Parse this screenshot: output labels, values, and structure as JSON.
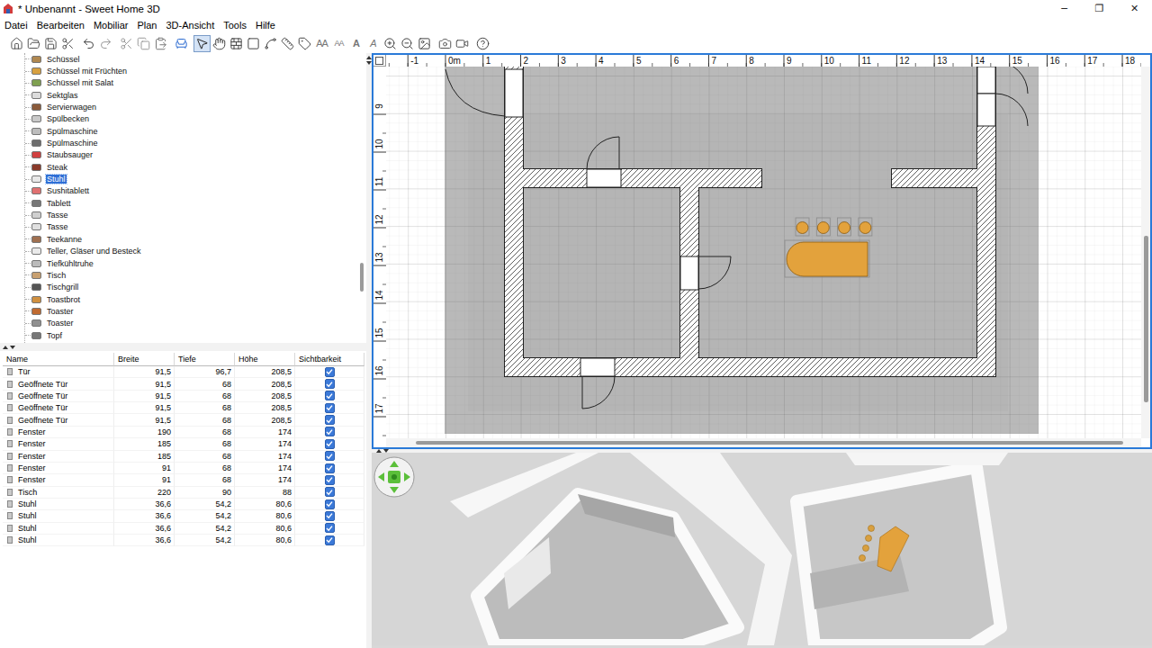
{
  "window": {
    "title": "* Unbenannt - Sweet Home 3D",
    "controls": [
      "─",
      "❐",
      "✕"
    ]
  },
  "menu": [
    "Datei",
    "Bearbeiten",
    "Mobiliar",
    "Plan",
    "3D-Ansicht",
    "Tools",
    "Hilfe"
  ],
  "toolbar": {
    "modes": [
      {
        "selected": true
      },
      {
        "selected": false
      },
      {
        "selected": false
      },
      {
        "selected": false
      },
      {
        "selected": false
      },
      {
        "selected": false
      },
      {
        "selected": false
      }
    ],
    "text_buttons": [
      {
        "glyph": "AA",
        "kind": "grow"
      },
      {
        "glyph": "AA",
        "kind": "shrink"
      },
      {
        "glyph": "A",
        "kind": "bold"
      },
      {
        "glyph": "A",
        "kind": "italic"
      }
    ]
  },
  "catalog": {
    "items": [
      {
        "name": "Schüssel",
        "selected": false
      },
      {
        "name": "Schüssel mit Früchten",
        "selected": false
      },
      {
        "name": "Schüssel mit Salat",
        "selected": false
      },
      {
        "name": "Sektglas",
        "selected": false
      },
      {
        "name": "Servierwagen",
        "selected": false
      },
      {
        "name": "Spülbecken",
        "selected": false
      },
      {
        "name": "Spülmaschine",
        "selected": false
      },
      {
        "name": "Spülmaschine",
        "selected": false
      },
      {
        "name": "Staubsauger",
        "selected": false
      },
      {
        "name": "Steak",
        "selected": false
      },
      {
        "name": "Stuhl",
        "selected": true
      },
      {
        "name": "Sushitablett",
        "selected": false
      },
      {
        "name": "Tablett",
        "selected": false
      },
      {
        "name": "Tasse",
        "selected": false
      },
      {
        "name": "Tasse",
        "selected": false
      },
      {
        "name": "Teekanne",
        "selected": false
      },
      {
        "name": "Teller, Gläser und Besteck",
        "selected": false
      },
      {
        "name": "Tiefkühltruhe",
        "selected": false
      },
      {
        "name": "Tisch",
        "selected": false
      },
      {
        "name": "Tischgrill",
        "selected": false
      },
      {
        "name": "Toastbrot",
        "selected": false
      },
      {
        "name": "Toaster",
        "selected": false
      },
      {
        "name": "Toaster",
        "selected": false
      },
      {
        "name": "Topf",
        "selected": false
      }
    ]
  },
  "furniture_table": {
    "columns": [
      "Name",
      "Breite",
      "Tiefe",
      "Höhe",
      "Sichtbarkeit"
    ],
    "rows": [
      {
        "name": "Tür",
        "width": "91,5",
        "depth": "96,7",
        "height": "208,5",
        "visible": true
      },
      {
        "name": "Geöffnete Tür",
        "width": "91,5",
        "depth": "68",
        "height": "208,5",
        "visible": true
      },
      {
        "name": "Geöffnete Tür",
        "width": "91,5",
        "depth": "68",
        "height": "208,5",
        "visible": true
      },
      {
        "name": "Geöffnete Tür",
        "width": "91,5",
        "depth": "68",
        "height": "208,5",
        "visible": true
      },
      {
        "name": "Geöffnete Tür",
        "width": "91,5",
        "depth": "68",
        "height": "208,5",
        "visible": true
      },
      {
        "name": "Fenster",
        "width": "190",
        "depth": "68",
        "height": "174",
        "visible": true
      },
      {
        "name": "Fenster",
        "width": "185",
        "depth": "68",
        "height": "174",
        "visible": true
      },
      {
        "name": "Fenster",
        "width": "185",
        "depth": "68",
        "height": "174",
        "visible": true
      },
      {
        "name": "Fenster",
        "width": "91",
        "depth": "68",
        "height": "174",
        "visible": true
      },
      {
        "name": "Fenster",
        "width": "91",
        "depth": "68",
        "height": "174",
        "visible": true
      },
      {
        "name": "Tisch",
        "width": "220",
        "depth": "90",
        "height": "88",
        "visible": true
      },
      {
        "name": "Stuhl",
        "width": "36,6",
        "depth": "54,2",
        "height": "80,6",
        "visible": true
      },
      {
        "name": "Stuhl",
        "width": "36,6",
        "depth": "54,2",
        "height": "80,6",
        "visible": true
      },
      {
        "name": "Stuhl",
        "width": "36,6",
        "depth": "54,2",
        "height": "80,6",
        "visible": true
      },
      {
        "name": "Stuhl",
        "width": "36,6",
        "depth": "54,2",
        "height": "80,6",
        "visible": true
      }
    ]
  },
  "plan": {
    "ruler_x": [
      "-1",
      "0m",
      "1",
      "2",
      "3",
      "4",
      "5",
      "6",
      "7",
      "8",
      "9",
      "10",
      "11",
      "12",
      "13",
      "14",
      "15",
      "16",
      "17",
      "18"
    ],
    "ruler_y": [
      "9",
      "10",
      "11",
      "12",
      "13",
      "14",
      "15",
      "16",
      "17"
    ]
  }
}
